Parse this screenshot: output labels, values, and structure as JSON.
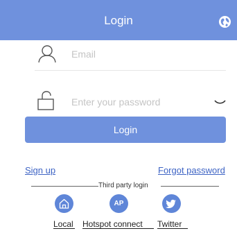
{
  "header": {
    "title": "Login"
  },
  "form": {
    "email_placeholder": "Email",
    "password_placeholder": "Enter your password",
    "login_label": "Login"
  },
  "links": {
    "sign_up": "Sign up",
    "forgot_password": "Forgot password"
  },
  "third_party": {
    "label": "Third party login",
    "ap_badge": "AP",
    "options": [
      {
        "label": "Local",
        "icon": "home-icon"
      },
      {
        "label": "Hotspot connect",
        "icon": "ap-icon"
      },
      {
        "label": "Twitter",
        "icon": "twitter-icon"
      }
    ]
  },
  "colors": {
    "accent": "#6f91dd",
    "link": "#3d63c4",
    "icon_circle": "#5f86d8"
  }
}
